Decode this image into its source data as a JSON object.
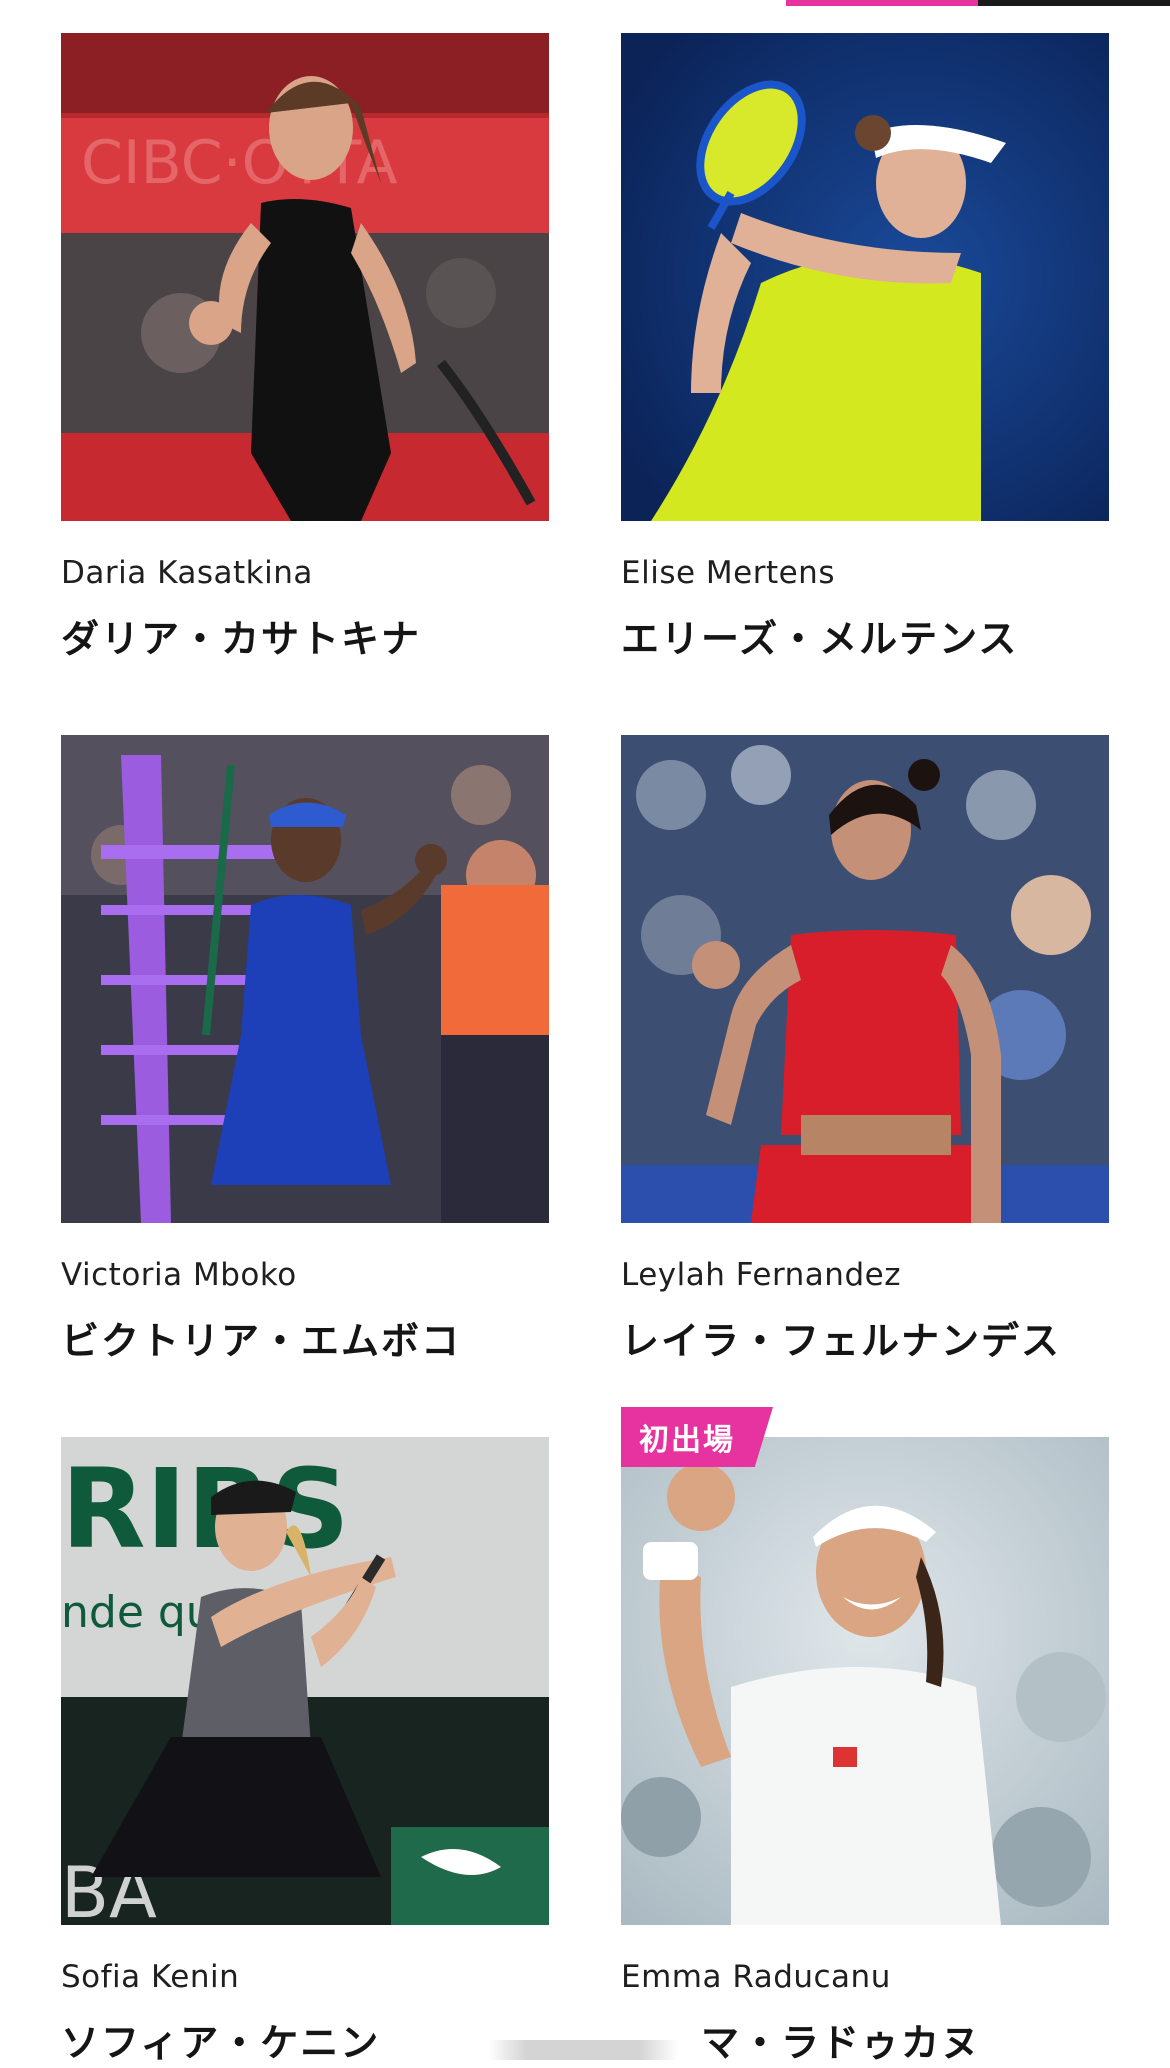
{
  "accent": {
    "pink": "#e6339f",
    "dark": "#1a1a1a"
  },
  "badge_label": "初出場",
  "players": [
    {
      "name_en": "Daria Kasatkina",
      "name_ja": "ダリア・カサトキナ",
      "photo": "daria-kasatkina-photo",
      "debut": false
    },
    {
      "name_en": "Elise Mertens",
      "name_ja": "エリーズ・メルテンス",
      "photo": "elise-mertens-photo",
      "debut": false
    },
    {
      "name_en": "Victoria Mboko",
      "name_ja": "ビクトリア・エムボコ",
      "photo": "victoria-mboko-photo",
      "debut": false
    },
    {
      "name_en": "Leylah Fernandez",
      "name_ja": "レイラ・フェルナンデス",
      "photo": "leylah-fernandez-photo",
      "debut": false
    },
    {
      "name_en": "Sofia Kenin",
      "name_ja": "ソフィア・ケニン",
      "photo": "sofia-kenin-photo",
      "debut": false
    },
    {
      "name_en": "Emma Raducanu",
      "name_ja": "マ・ラドゥカヌ",
      "photo": "emma-raducanu-photo",
      "debut": true
    }
  ]
}
